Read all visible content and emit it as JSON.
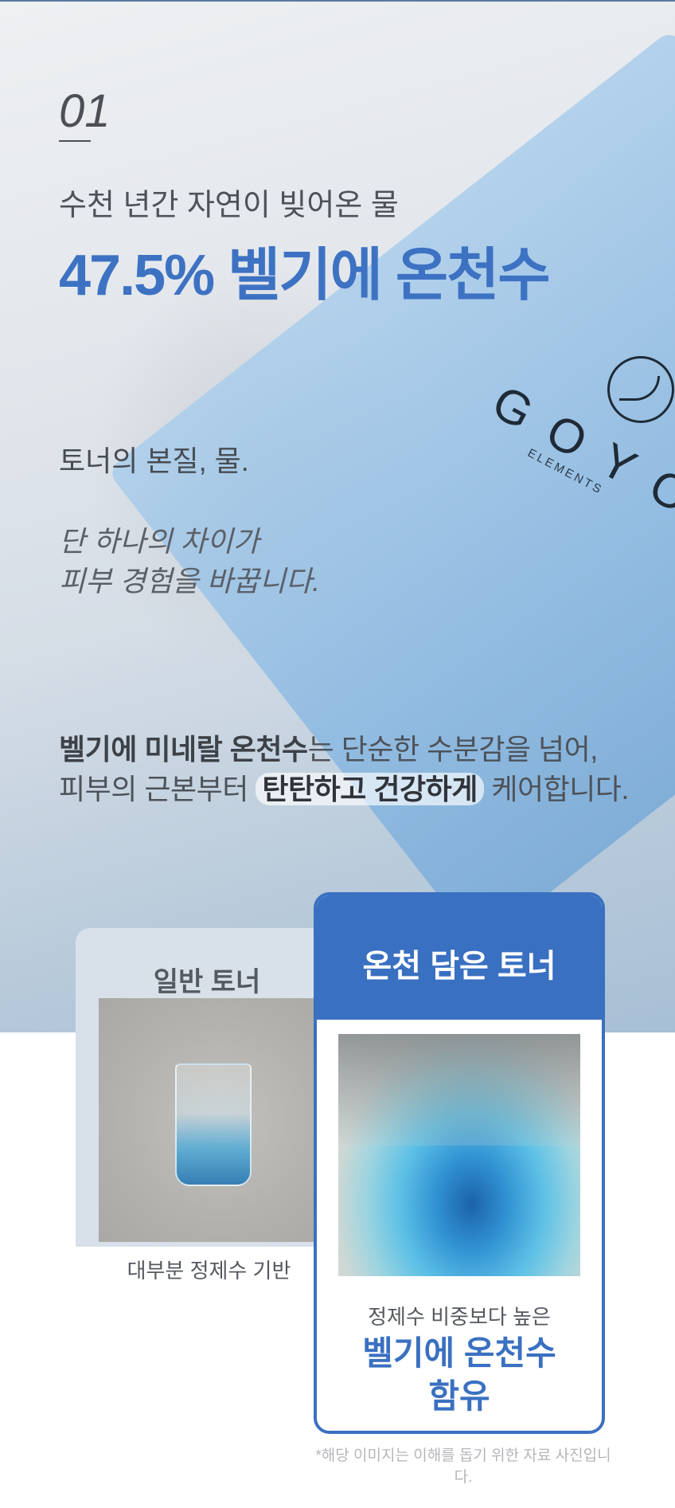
{
  "hero": {
    "number": "01",
    "subtitle": "수천 년간 자연이 빚어온 물",
    "headline": "47.5% 벨기에 온천수",
    "essence": "토너의 본질, 물.",
    "diff_line1": "단 하나의 차이가",
    "diff_line2": "피부 경험을 바꿉니다.",
    "desc": {
      "bold1": "벨기에 미네랄 온천수",
      "text1": "는 단순한 수분감을 넘어,",
      "text2": "피부의 근본부터 ",
      "highlight": "탄탄하고 건강하게",
      "text3": " 케어합니다."
    },
    "product": {
      "brand": "GOYO",
      "brand_sub": "ELEMENTS"
    }
  },
  "compare": {
    "left": {
      "title": "일반 토너",
      "caption": "대부분 정제수 기반"
    },
    "right": {
      "title": "온천 담은 토너",
      "caption1": "정제수 비중보다 높은",
      "caption2": "벨기에 온천수",
      "caption3": "함유"
    },
    "disclaimer": "*해당 이미지는 이해를 돕기 위한 자료 사진입니다."
  },
  "colors": {
    "accent": "#3a70c1",
    "text": "#4d5259",
    "card_bg": "#d8e1ea"
  }
}
